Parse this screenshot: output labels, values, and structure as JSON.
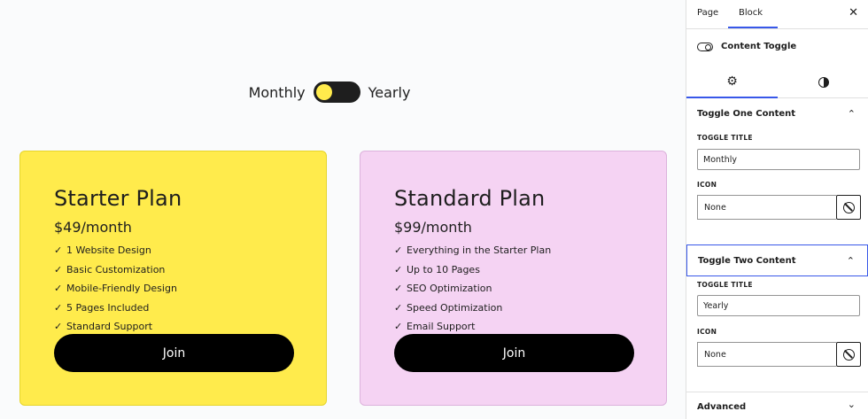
{
  "canvas": {
    "toggle": {
      "left_label": "Monthly",
      "right_label": "Yearly",
      "knob_color": "#ffeb4c",
      "state": "monthly"
    },
    "cards": [
      {
        "title": "Starter Plan",
        "price": "$49/month",
        "background": "#ffeb4c",
        "features": [
          "1 Website Design",
          "Basic Customization",
          "Mobile-Friendly Design",
          "5 Pages Included",
          "Standard Support"
        ],
        "button_label": "Join"
      },
      {
        "title": "Standard Plan",
        "price": "$99/month",
        "background": "#f5d3f3",
        "features": [
          "Everything in the Starter Plan",
          "Up to 10 Pages",
          "SEO Optimization",
          "Speed Optimization",
          "Email Support"
        ],
        "button_label": "Join"
      }
    ],
    "check_glyph": "✓"
  },
  "sidebar": {
    "tabs": {
      "page": "Page",
      "block": "Block",
      "active": "Block"
    },
    "close_glyph": "✕",
    "block_name": "Content Toggle",
    "mode_tabs": {
      "settings_icon": "gear-icon",
      "styles_icon": "contrast-icon",
      "active": "settings"
    },
    "panels": {
      "toggle_one": {
        "title": "Toggle One Content",
        "title_label": "TOGGLE TITLE",
        "title_value": "Monthly",
        "icon_label": "ICON",
        "icon_value": "None"
      },
      "toggle_two": {
        "title": "Toggle Two Content",
        "title_label": "TOGGLE TITLE",
        "title_value": "Yearly",
        "icon_label": "ICON",
        "icon_value": "None"
      },
      "advanced": {
        "title": "Advanced"
      }
    },
    "chevron_up": "⌃",
    "chevron_down": "⌄"
  },
  "colors": {
    "accent": "#3858e9"
  }
}
